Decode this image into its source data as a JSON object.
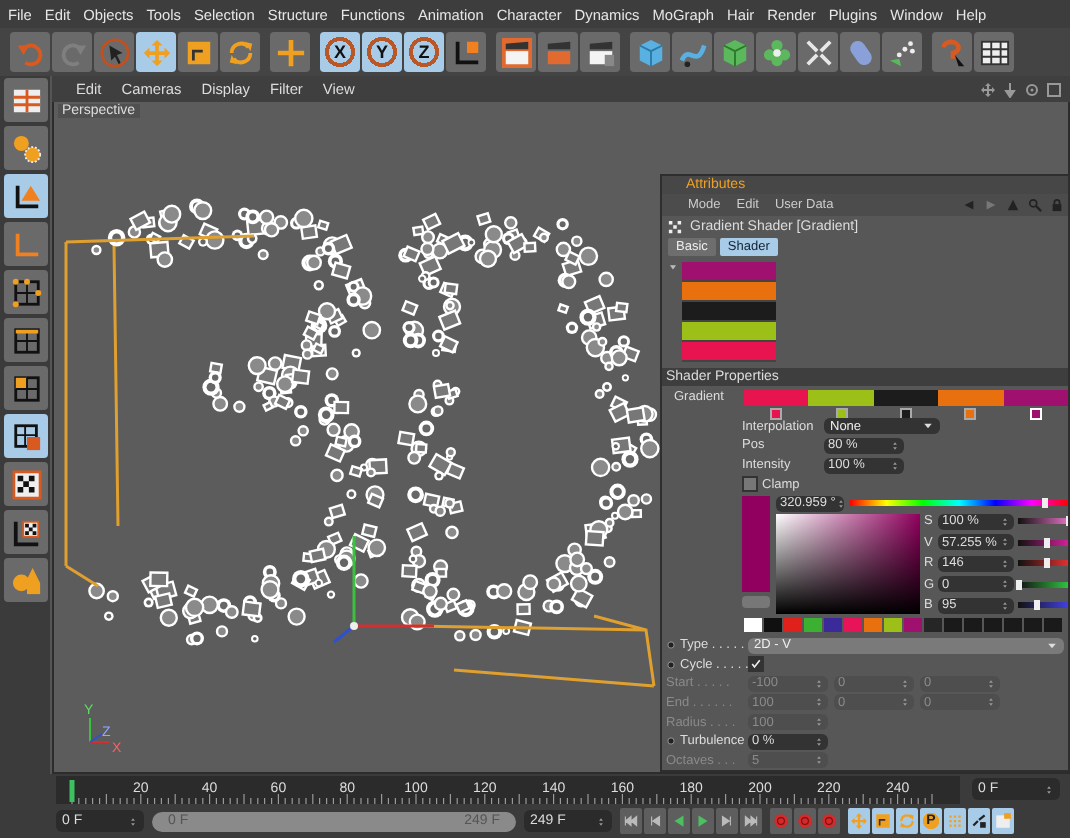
{
  "menu_bar": [
    "File",
    "Edit",
    "Objects",
    "Tools",
    "Selection",
    "Structure",
    "Functions",
    "Animation",
    "Character",
    "Dynamics",
    "MoGraph",
    "Hair",
    "Render",
    "Plugins",
    "Window",
    "Help"
  ],
  "toolbar": {
    "groups": [
      [
        {
          "selected": false,
          "disabled": false
        },
        {
          "selected": false,
          "disabled": true
        },
        {
          "selected": false,
          "disabled": false
        },
        {
          "selected": true,
          "disabled": false
        },
        {
          "selected": false,
          "disabled": false
        },
        {
          "selected": false,
          "disabled": false
        }
      ],
      [
        {
          "selected": false,
          "disabled": false
        }
      ],
      [
        {
          "label": "X",
          "selected": true,
          "disabled": false
        },
        {
          "label": "Y",
          "selected": true,
          "disabled": false
        },
        {
          "label": "Z",
          "selected": true,
          "disabled": false
        },
        {
          "selected": false,
          "disabled": false
        }
      ],
      [
        {
          "selected": false,
          "disabled": false
        },
        {
          "selected": false,
          "disabled": false
        },
        {
          "selected": false,
          "disabled": false
        }
      ],
      [
        {
          "selected": false,
          "disabled": false
        },
        {
          "selected": false,
          "disabled": false
        },
        {
          "selected": false,
          "disabled": false
        },
        {
          "selected": false,
          "disabled": false
        },
        {
          "selected": false,
          "disabled": false
        },
        {
          "selected": false,
          "disabled": false
        },
        {
          "selected": false,
          "disabled": false
        }
      ],
      [
        {
          "selected": false,
          "disabled": false
        },
        {
          "selected": false,
          "disabled": false
        }
      ]
    ]
  },
  "left_toolbar": [
    {
      "selected": false
    },
    {
      "selected": false
    },
    {
      "selected": true
    },
    {
      "selected": false
    },
    {
      "selected": false
    },
    {
      "selected": false
    },
    {
      "selected": false
    },
    {
      "selected": true
    },
    {
      "selected": false
    },
    {
      "selected": false
    },
    {
      "selected": false
    }
  ],
  "viewport": {
    "menu": [
      "Edit",
      "Cameras",
      "Display",
      "Filter",
      "View"
    ],
    "camera": "Perspective",
    "axis_labels": [
      "Y",
      "Z",
      "X"
    ]
  },
  "attributes": {
    "title": "Attributes",
    "menu": [
      "Mode",
      "Edit",
      "User Data"
    ],
    "object": "Gradient Shader [Gradient]",
    "tabs": [
      {
        "label": "Basic",
        "selected": false
      },
      {
        "label": "Shader",
        "selected": true
      }
    ],
    "preview": [
      {
        "color": "#a0106e"
      },
      {
        "color": "#e8700f"
      },
      {
        "color": "#1c1c1c"
      },
      {
        "color": "#9cc017"
      },
      {
        "color": "#e8144f"
      }
    ],
    "section": "Shader Properties",
    "gradient": {
      "label": "Gradient",
      "knots": [
        {
          "color": "#e8144f",
          "selected": false
        },
        {
          "color": "#9cc017",
          "selected": false
        },
        {
          "color": "#1c1c1c",
          "selected": false
        },
        {
          "color": "#e8700f",
          "selected": false
        },
        {
          "color": "#a0106e",
          "selected": true
        }
      ]
    },
    "knot_params": [
      {
        "kind": "dropdown",
        "label": "Interpolation",
        "value": "None"
      },
      {
        "kind": "number",
        "label": "Pos",
        "value": "80 %"
      },
      {
        "kind": "number",
        "label": "Intensity",
        "value": "100 %"
      },
      {
        "kind": "checkbox",
        "label": "Clamp",
        "checked": false
      }
    ],
    "color_picker": {
      "color": "#92005f",
      "hue": {
        "value": "320.959 °",
        "level": 0.89
      },
      "channels": [
        {
          "label": "S",
          "value": "100 %",
          "level": 1
        },
        {
          "label": "V",
          "value": "57.255 %",
          "level": 0.57
        },
        {
          "label": "R",
          "value": "146",
          "level": 0.57
        },
        {
          "label": "G",
          "value": "0",
          "level": 0
        },
        {
          "label": "B",
          "value": "95",
          "level": 0.37
        }
      ],
      "swatches": [
        {
          "color": "#ffffff"
        },
        {
          "color": "#101010"
        },
        {
          "color": "#e0201a"
        },
        {
          "color": "#3cb030"
        },
        {
          "color": "#3a2a9a"
        },
        {
          "color": "#e8145a"
        },
        {
          "color": "#e8700f"
        },
        {
          "color": "#9cc017"
        },
        {
          "color": "#a0106e"
        },
        {
          "color": "#262626"
        },
        {
          "color": "#1a1a1a"
        },
        {
          "color": "#1a1a1a"
        },
        {
          "color": "#1a1a1a"
        },
        {
          "color": "#1a1a1a"
        },
        {
          "color": "#1a1a1a"
        },
        {
          "color": "#1a1a1a"
        }
      ]
    },
    "params": [
      {
        "kind": "dropdown",
        "label": "Type . . . . .",
        "value": "2D - V",
        "disabled": false
      },
      {
        "kind": "checkbox",
        "label": "Cycle . . . . .",
        "checked": true,
        "disabled": false
      },
      {
        "kind": "vector",
        "label": "Start . . . . .",
        "values": [
          "-100",
          "0",
          "0"
        ],
        "disabled": true
      },
      {
        "kind": "vector",
        "label": "End . . . . . .",
        "values": [
          "100",
          "0",
          "0"
        ],
        "disabled": true
      },
      {
        "kind": "number",
        "label": "Radius . . . .",
        "value": "100",
        "disabled": true
      },
      {
        "kind": "number",
        "label": "Turbulence",
        "value": "0 %",
        "disabled": false
      },
      {
        "kind": "number",
        "label": "Octaves . . .",
        "value": "5",
        "disabled": true
      }
    ]
  },
  "timeline": {
    "ruler_labels": [
      "20",
      "40",
      "60",
      "80",
      "100",
      "120",
      "140",
      "160",
      "180",
      "200",
      "220",
      "240"
    ],
    "current_frame": "0 F",
    "start_field": "0 F",
    "range": {
      "start": "0 F",
      "end": "249 F",
      "level": 1
    },
    "end_field": "249 F",
    "key_tools": [
      {
        "selected": true
      },
      {
        "selected": true
      },
      {
        "selected": true
      },
      {
        "label": "P",
        "selected": true
      },
      {
        "selected": true
      },
      {
        "selected": true
      },
      {
        "selected": true
      }
    ]
  }
}
